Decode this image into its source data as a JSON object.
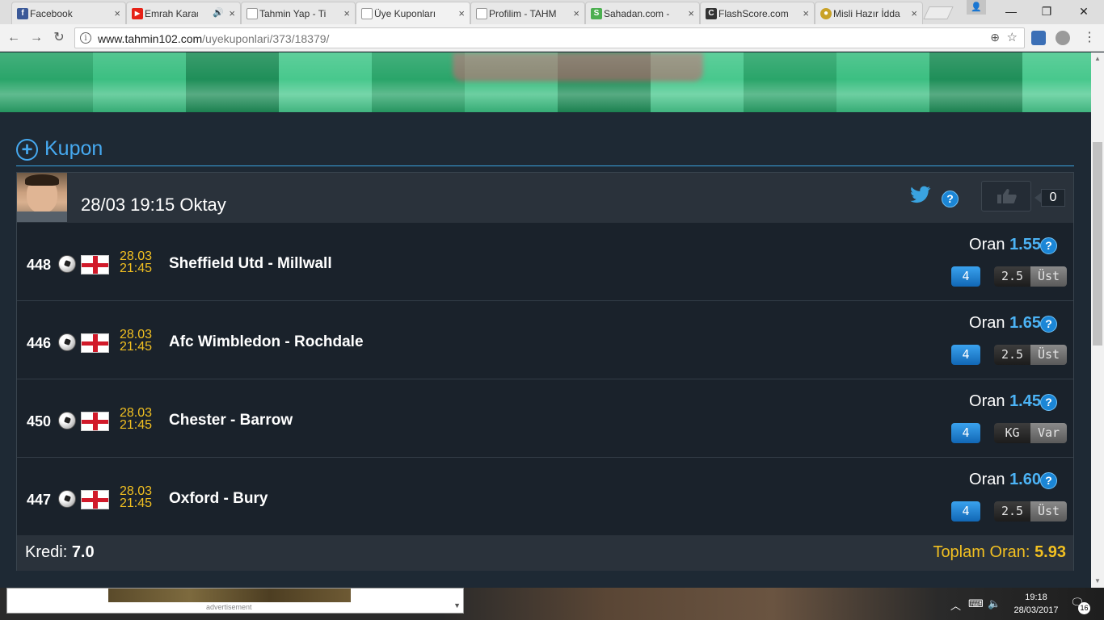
{
  "browser": {
    "tabs": [
      {
        "title": "Facebook",
        "favicon_color": "#3b5998",
        "favicon_glyph": "f"
      },
      {
        "title": "Emrah Karad",
        "favicon_color": "#e62117",
        "favicon_glyph": "▶",
        "audio": "🔊"
      },
      {
        "title": "Tahmin Yap - Ti",
        "favicon_color": "#bbbbbb",
        "favicon_glyph": ""
      },
      {
        "title": "Üye Kuponları",
        "favicon_color": "#bbbbbb",
        "favicon_glyph": ""
      },
      {
        "title": "Profilim - TAHM",
        "favicon_color": "#bbbbbb",
        "favicon_glyph": ""
      },
      {
        "title": "Sahadan.com -",
        "favicon_color": "#4caf50",
        "favicon_glyph": "S"
      },
      {
        "title": "FlashScore.com",
        "favicon_color": "#333333",
        "favicon_glyph": "C"
      },
      {
        "title": "Misli Hazır İdda",
        "favicon_color": "#c9a227",
        "favicon_glyph": "●"
      }
    ],
    "url_host": "www.tahmin102.com",
    "url_path": "/uyekuponlari/373/18379/",
    "close_glyph": "×",
    "min_glyph": "—",
    "restore_glyph": "❐",
    "close_window_glyph": "✕",
    "back_glyph": "←",
    "forward_glyph": "→",
    "reload_glyph": "↻",
    "info_glyph": "i",
    "zoom_glyph": "⊕",
    "star_glyph": "☆",
    "menu_glyph": "⋮",
    "profile_glyph": "👤"
  },
  "section": {
    "plus_glyph": "+",
    "title": "Kupon"
  },
  "coupon": {
    "header": "28/03 19:15 Oktay",
    "help_glyph": "?",
    "like_count": "0",
    "rows": [
      {
        "code": "448",
        "date": "28.03",
        "time": "21:45",
        "match": "Sheffield Utd - Millwall",
        "oran_label": "Oran",
        "oran": "1.55",
        "pick_code": "4",
        "bet_left": "2.5",
        "bet_right": "Üst"
      },
      {
        "code": "446",
        "date": "28.03",
        "time": "21:45",
        "match": "Afc Wimbledon - Rochdale",
        "oran_label": "Oran",
        "oran": "1.65",
        "pick_code": "4",
        "bet_left": "2.5",
        "bet_right": "Üst"
      },
      {
        "code": "450",
        "date": "28.03",
        "time": "21:45",
        "match": "Chester - Barrow",
        "oran_label": "Oran",
        "oran": "1.45",
        "pick_code": "4",
        "bet_left": "KG",
        "bet_right": "Var"
      },
      {
        "code": "447",
        "date": "28.03",
        "time": "21:45",
        "match": "Oxford - Bury",
        "oran_label": "Oran",
        "oran": "1.60",
        "pick_code": "4",
        "bet_left": "2.5",
        "bet_right": "Üst"
      }
    ],
    "kredi_label": "Kredi:",
    "kredi_value": "7.0",
    "toplam_label": "Toplam Oran:",
    "toplam_value": "5.93"
  },
  "taskbar": {
    "ad_label": "advertisement",
    "ad_arrow": "▼",
    "clock_time": "19:18",
    "clock_date": "28/03/2017",
    "notification_count": "16",
    "tray_chevron": "︿",
    "tray_network": "⌨",
    "tray_volume": "🔈",
    "tray_notif_glyph": "🗨"
  },
  "scrollbar": {
    "up_glyph": "▲",
    "down_glyph": "▼"
  },
  "colors": {
    "accent": "#46a9f0",
    "odds": "#4cb3f5",
    "date": "#f2c021",
    "total": "#f2c021"
  }
}
